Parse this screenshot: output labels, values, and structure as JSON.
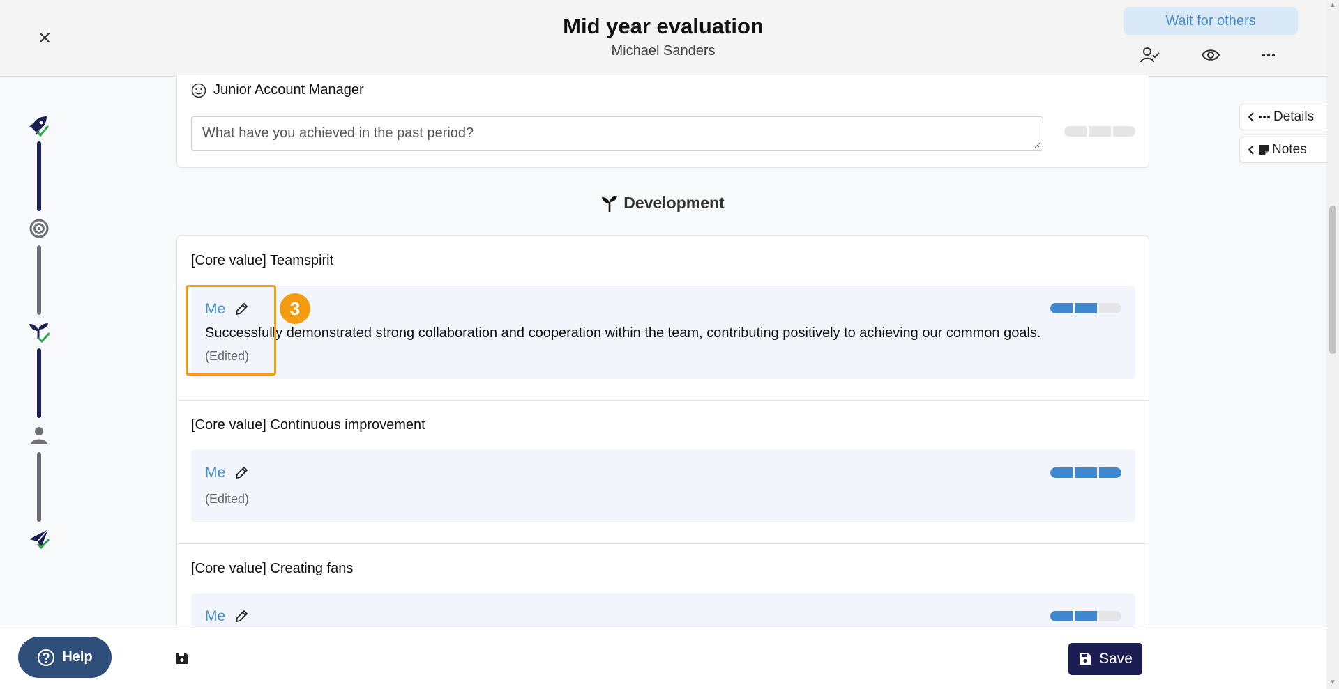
{
  "header": {
    "title": "Mid year evaluation",
    "subtitle": "Michael Sanders",
    "wait_label": "Wait for others",
    "icons": [
      "close-icon",
      "person-check-icon",
      "eye-icon",
      "more-icon"
    ]
  },
  "side_tabs": {
    "details_label": "Details",
    "notes_label": "Notes"
  },
  "stepper": {
    "steps": [
      {
        "icon": "rocket-icon",
        "done": true
      },
      {
        "icon": "target-icon",
        "done": false
      },
      {
        "icon": "sprout-icon",
        "done": true
      },
      {
        "icon": "person-icon",
        "done": false
      },
      {
        "icon": "send-icon",
        "done": true
      }
    ]
  },
  "achievements": {
    "role": "Junior Account Manager",
    "placeholder": "What have you achieved in the past period?"
  },
  "development": {
    "heading": "Development",
    "items": [
      {
        "title": "[Core value] Teamspirit",
        "author": "Me",
        "text": "Successfully demonstrated strong collaboration and cooperation within the team, contributing positively to achieving our common goals.",
        "status": "(Edited)",
        "rating": 2,
        "rating_max": 3
      },
      {
        "title": "[Core value] Continuous improvement",
        "author": "Me",
        "text": "",
        "status": "(Edited)",
        "rating": 3,
        "rating_max": 3
      },
      {
        "title": "[Core value] Creating fans",
        "author": "Me",
        "text": "",
        "status": "",
        "rating": 2,
        "rating_max": 3
      }
    ]
  },
  "annotation": {
    "badge": "3",
    "color": "#f39c12"
  },
  "footer": {
    "help_label": "Help",
    "save_label": "Save"
  },
  "colors": {
    "accent": "#4a90cf",
    "primary_dark": "#1c1d52",
    "check_green": "#2ea44f"
  }
}
